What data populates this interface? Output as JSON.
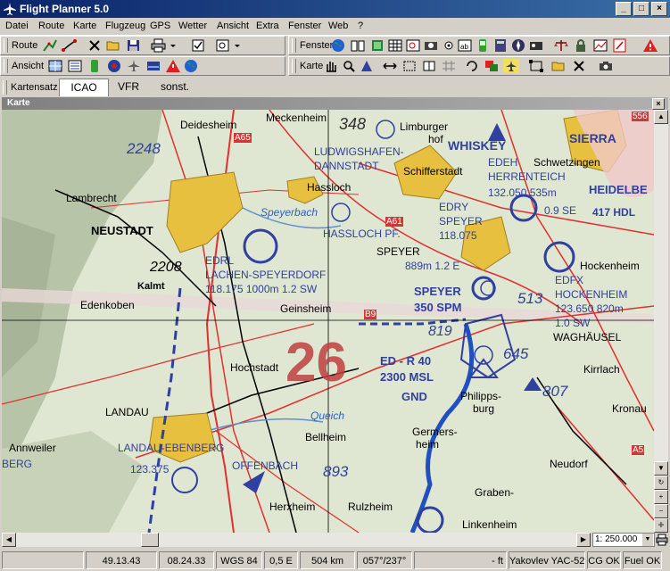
{
  "window": {
    "title": "Flight Planner 5.0",
    "btn_min": "_",
    "btn_max": "□",
    "btn_close": "×"
  },
  "menu": [
    "Datei",
    "Route",
    "Karte",
    "Flugzeug",
    "GPS",
    "Wetter",
    "Ansicht",
    "Extra",
    "Fenster",
    "Web",
    "?"
  ],
  "toolbars": {
    "route_label": "Route",
    "fenster_label": "Fenster",
    "ansicht_label": "Ansicht",
    "karte_label": "Karte",
    "kartensatz_label": "Kartensatz"
  },
  "tabs": [
    {
      "label": "ICAO",
      "active": true
    },
    {
      "label": "VFR",
      "active": false
    },
    {
      "label": "sonst.",
      "active": false
    }
  ],
  "map_window": {
    "caption": "Karte",
    "close": "×"
  },
  "map": {
    "labels": {
      "deidesheim": "Deidesheim",
      "meckenheim": "Meckenheim",
      "elev348": "348",
      "limburger": "Limburger",
      "hof": "hof",
      "whiskey": "WHISKEY",
      "sierra": "SIERRA",
      "elev2248": "2248",
      "ludwigshafen": "LUDWIGSHAFEN-",
      "dannstadt": "DANNSTADT",
      "schifferstadt": "Schifferstadt",
      "edeh": "EDEH",
      "herrenteich": "HERRENTEICH",
      "schwetzingen": "Schwetzingen",
      "edeh_freq": "132.050 535m",
      "heidelbe": "HEIDELBE",
      "lambrecht": "Lambrecht",
      "hassloch": "Hassloch",
      "speyerbach": "Speyerbach",
      "edry": "EDRY",
      "edry_dist": "0.9 SE",
      "hdl": "417 HDL",
      "neustadt": "NEUSTADT",
      "hassloch_pf": "HASSLOCH PF.",
      "speyer_rwy": "SPEYER",
      "speyer_freq": "118.075",
      "edrl": "EDRL",
      "speyer_town": "SPEYER",
      "speyer_elev": "889m 1.2 E",
      "hockenheim": "Hockenheim",
      "elev2208": "2208",
      "lachen": "LACHEN-SPEYERDORF",
      "kalmt": "Kalmt",
      "edrl_freq": "118.175 1000m 1.2 SW",
      "speyer_vor": "SPEYER",
      "elev513": "513",
      "edfx": "EDFX",
      "edfx_name": "HOCKENHEIM",
      "edenkoben": "Edenkoben",
      "geinsheim": "Geinsheim",
      "spm": "350 SPM",
      "edfx_freq": "123.650 820m",
      "edfx_dist": "1.0 SW",
      "elev819": "819",
      "waghausel": "WAGHÄUSEL",
      "sector": "26",
      "elev645": "645",
      "hochstadt": "Hochstadt",
      "edr": "ED - R 40",
      "msl": "2300 MSL",
      "kirrlach": "Kirrlach",
      "gnd": "GND",
      "philipps": "Philipps-",
      "burg": "burg",
      "elev807": "807",
      "kronau": "Kronau",
      "landau": "LANDAU",
      "queich": "Queich",
      "bellheim": "Bellheim",
      "germers": "Germers-",
      "heim": "heim",
      "annweiler": "Annweiler",
      "landau_eb": "LANDAU-EBENBERG",
      "neudorf": "Neudorf",
      "berg": "BERG",
      "landau_freq": "123.375",
      "offenbach": "OFFENBACH",
      "elev893": "893",
      "graben": "Graben-",
      "herxheim": "Herxheim",
      "rulzheim": "Rulzheim",
      "linkenheim": "Linkenheim",
      "a65": "A65",
      "a61": "A61",
      "a5": "A5",
      "b9": "B9",
      "elev556": "556"
    }
  },
  "scale": {
    "value": "1: 250.000"
  },
  "status": {
    "lat": "49.13.43",
    "lon": "08.24.33",
    "datum": "WGS 84",
    "variation": "0,5 E",
    "distance": "504 km",
    "course": "057°/237°",
    "alt": "- ft",
    "aircraft": "Yakovlev YAC-52",
    "cg": "CG OK",
    "fuel": "Fuel OK"
  },
  "colors": {
    "titlebar": "#0a246a",
    "airspace": "#3040a0",
    "roads": "#e03030",
    "towns": "#e8c040",
    "water": "#2050c0",
    "terrain": "#dfe6d2"
  }
}
